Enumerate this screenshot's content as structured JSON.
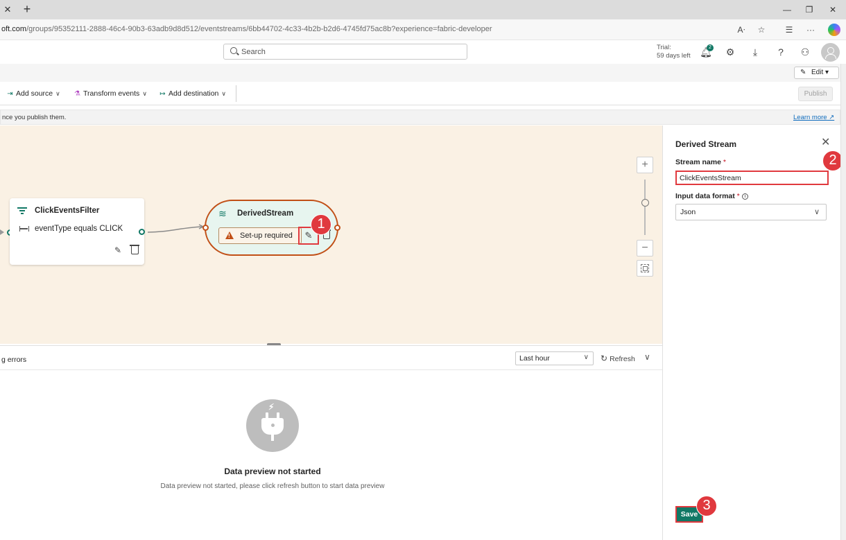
{
  "browser": {
    "tab_close_glyph": "✕",
    "new_tab_glyph": "+",
    "url_domain": "oft.com",
    "url_path": "/groups/95352111-2888-46c4-90b3-63adb9d8d512/eventstreams/6bb44702-4c33-4b2b-b2d6-4745fd75ac8b?experience=fabric-developer"
  },
  "header": {
    "search_placeholder": "Search",
    "trial_line1": "Trial:",
    "trial_line2": "59 days left",
    "notification_count": "2"
  },
  "editbar": {
    "edit_label": "Edit"
  },
  "toolbar": {
    "add_source": "Add source",
    "transform_events": "Transform events",
    "add_destination": "Add destination",
    "publish": "Publish"
  },
  "infobar": {
    "text": "nce you publish them.",
    "learn_more": "Learn more"
  },
  "canvas": {
    "filter_node": {
      "title": "ClickEventsFilter",
      "condition": "eventType equals CLICK"
    },
    "derived_node": {
      "title": "DerivedStream",
      "status": "Set-up required"
    },
    "callouts": [
      "1",
      "2",
      "3"
    ]
  },
  "bottom_panel": {
    "tab_label": "g errors",
    "time_range": "Last hour",
    "refresh": "Refresh",
    "empty_title": "Data preview not started",
    "empty_subtitle": "Data preview not started, please click refresh button to start data preview"
  },
  "right_panel": {
    "title": "Derived Stream",
    "stream_name_label": "Stream name",
    "stream_name_value": "ClickEventsStream",
    "input_format_label": "Input data format",
    "input_format_value": "Json",
    "save": "Save"
  },
  "colors": {
    "accent_green": "#117865",
    "warning_orange": "#c14f16",
    "callout_red": "#e0393e",
    "canvas_bg": "#faf1e4"
  }
}
